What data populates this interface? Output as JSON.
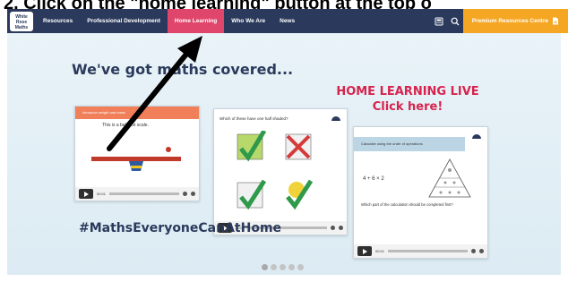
{
  "instruction": "2. Click on the \"home learning\" button at the top o",
  "nav": {
    "logo": [
      "White",
      "Rose",
      "Maths"
    ],
    "items": [
      "Resources",
      "Professional Development",
      "Home Learning",
      "Who We Are",
      "News"
    ],
    "active_item": "Home Learning",
    "premium_label": "Premium Resources Centre",
    "icons": [
      "calculator-icon",
      "search-icon",
      "document-icon"
    ]
  },
  "hero": {
    "headline": "We've got maths covered...",
    "live_line1": "HOME LEARNING LIVE",
    "live_line2": "Click here!",
    "hashtag": "#MathsEveryoneCanAtHome"
  },
  "cards": {
    "card1": {
      "banner": "Introduce weight and mass",
      "text": "This is a balance scale.",
      "time": "00:01"
    },
    "card2": {
      "question": "Which of these have one half shaded?",
      "time": "00:01"
    },
    "card3": {
      "banner": "Calculate using the order of operations",
      "expression": "4 + 6 × 2",
      "question": "Which part of the calculation should be completed first?",
      "time": "00:01"
    }
  },
  "carousel": {
    "count": 5,
    "active": 1
  },
  "colors": {
    "nav_bg": "#2b3a5c",
    "active_tab": "#e0456b",
    "premium": "#f5a623",
    "live_text": "#d6234d",
    "arrow": "#000000"
  }
}
